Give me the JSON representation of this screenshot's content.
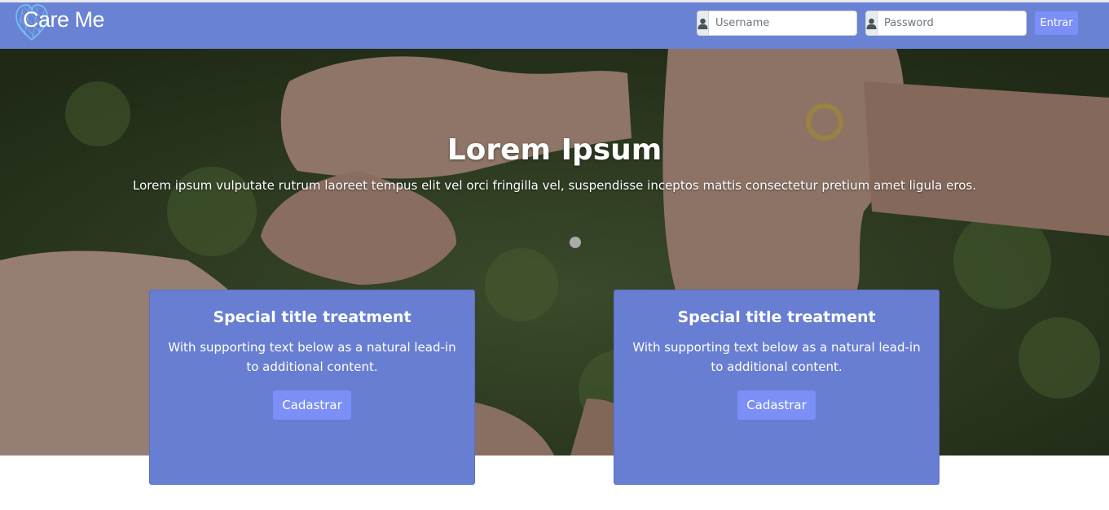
{
  "brand": {
    "name": "Care Me",
    "logo_icon": "heart-icon"
  },
  "login": {
    "username_placeholder": "Username",
    "password_placeholder": "Password",
    "user_icon": "user-icon",
    "submit_label": "Entrar"
  },
  "hero": {
    "title": "Lorem Ipsum",
    "subtitle": "Lorem ipsum vulputate rutrum laoreet tempus elit vel orci fringilla vel, suspendisse inceptos mattis consectetur pretium amet ligula eros."
  },
  "cards": [
    {
      "title": "Special title treatment",
      "text": "With supporting text below as a natural lead-in to additional content.",
      "button_label": "Cadastrar"
    },
    {
      "title": "Special title treatment",
      "text": "With supporting text below as a natural lead-in to additional content.",
      "button_label": "Cadastrar"
    }
  ],
  "colors": {
    "navbar": "#6a82d4",
    "card": "#687ed2",
    "button": "#7b8ff7"
  }
}
